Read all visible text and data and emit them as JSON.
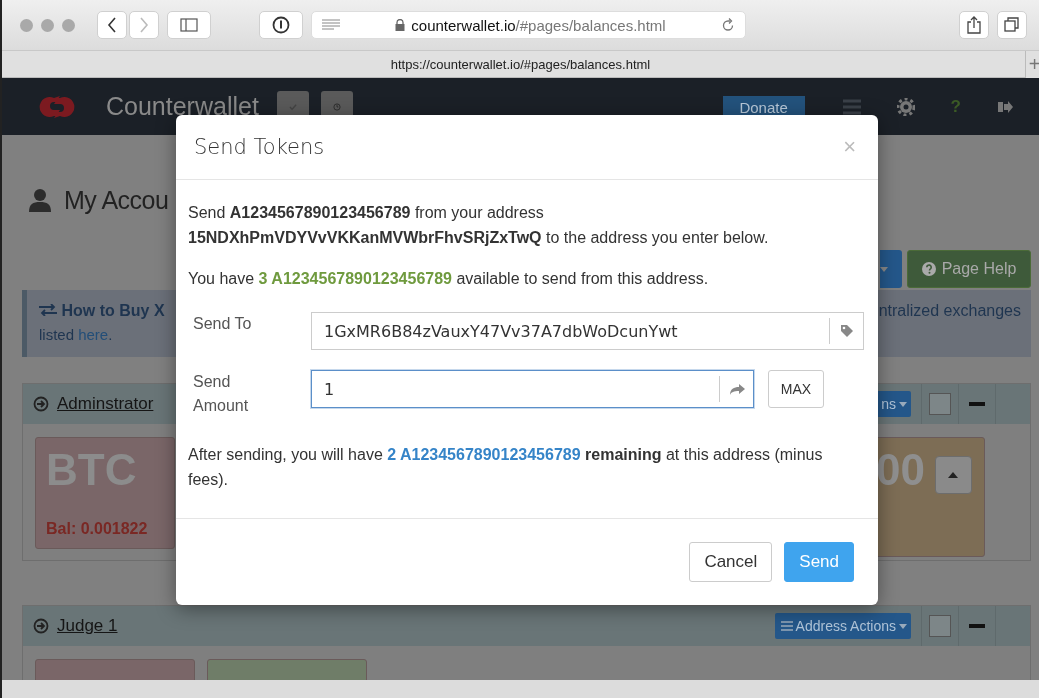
{
  "browser": {
    "url_domain": "counterwallet.io",
    "url_path": "/#pages/balances.html",
    "tab_title": "https://counterwallet.io/#pages/balances.html",
    "new_tab": "+"
  },
  "nav": {
    "brand": "Counterwallet",
    "donate": "Donate",
    "help": "?"
  },
  "page": {
    "heading": "My Accou",
    "help_button": "Page Help",
    "alert": {
      "title": "How to Buy X",
      "line_end": "ntralized exchanges",
      "line2_before": "listed",
      "link": "here",
      "line2_after": "."
    }
  },
  "addresses": [
    {
      "name": "Adminstrator",
      "actions": "ns",
      "checked": false,
      "cards": [
        {
          "color": "#7a6668",
          "asset": "BTC",
          "balance": "Bal: 0.001822"
        }
      ],
      "right_cards": [
        {
          "color": "#7d6d55",
          "amount": "00"
        }
      ]
    },
    {
      "name": "Judge 1",
      "actions": "Address Actions",
      "checked": false,
      "cards": [
        {
          "color": "#7a6668"
        },
        {
          "color": "#6f7d68"
        }
      ]
    }
  ],
  "modal": {
    "title": "Send Tokens",
    "close": "×",
    "intro": "Send **A1234567890123456789** from your address **15NDXhPmVDYVvVKKanMVWbrFhvSRjZxTwQ** to the address you enter below.",
    "available": {
      "before": "You have",
      "amount": "3 A1234567890123456789",
      "after": "available to send from this address."
    },
    "fields": [
      {
        "kind": "address",
        "label": "Send To",
        "value": "1GxMR6B84zVauxY47Vv37A7dbWoDcunYwt",
        "focused": false
      },
      {
        "kind": "amount",
        "label": "Send Amount",
        "value": "1",
        "focused": true,
        "extra_button": "MAX"
      }
    ],
    "remaining": {
      "before": "After sending, you will have",
      "amount": "2 A1234567890123456789",
      "after": "**remaining** at this address (minus fees)."
    },
    "buttons": [
      {
        "label": "Cancel",
        "primary": false
      },
      {
        "label": "Send",
        "primary": true
      }
    ]
  }
}
